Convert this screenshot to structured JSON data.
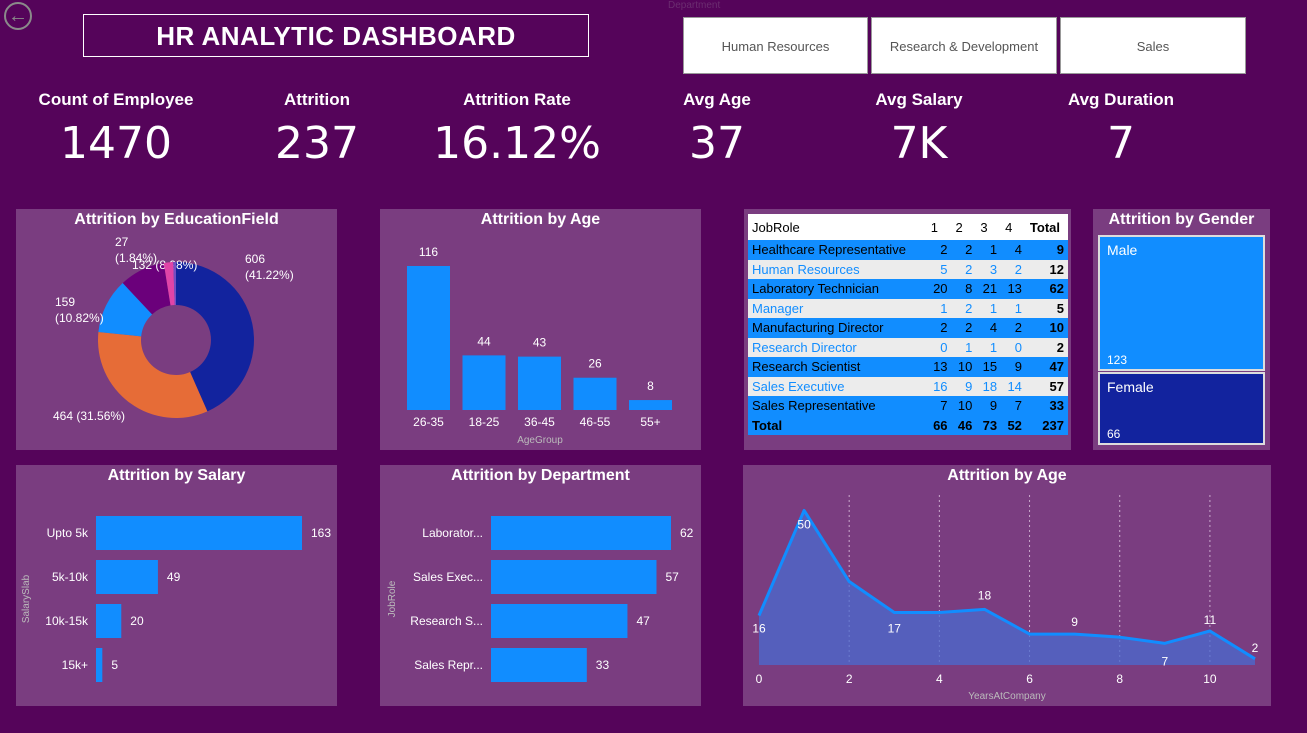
{
  "header": {
    "title": "HR ANALYTIC DASHBOARD",
    "back_icon": "arrow-left-icon"
  },
  "slicer": {
    "label": "Department",
    "options": [
      "Human Resources",
      "Research & Development",
      "Sales"
    ]
  },
  "kpis": [
    {
      "label": "Count of Employee",
      "value": "1470"
    },
    {
      "label": "Attrition",
      "value": "237"
    },
    {
      "label": "Attrition Rate",
      "value": "16.12%"
    },
    {
      "label": "Avg Age",
      "value": "37"
    },
    {
      "label": "Avg Salary",
      "value": "7K"
    },
    {
      "label": "Avg Duration",
      "value": "7"
    }
  ],
  "colors": {
    "background": "#55045a",
    "panel": "#7a3d80",
    "bar": "#118dff",
    "dark_blue": "#12239e"
  },
  "chart_data": [
    {
      "type": "pie",
      "title": "Attrition by EducationField",
      "slices": [
        {
          "value": 606,
          "label": "606",
          "pct": "(41.22%)",
          "color": "#12239e"
        },
        {
          "value": 464,
          "label": "464 (31.56%)",
          "pct": "",
          "color": "#e66c37"
        },
        {
          "value": 159,
          "label": "159",
          "pct": "(10.82%)",
          "color": "#118dff"
        },
        {
          "value": 132,
          "label": "132 (8.98%)",
          "pct": "",
          "color": "#6b007b"
        },
        {
          "value": 27,
          "label": "27",
          "pct": "(1.84%)",
          "color": "#e044a7"
        },
        {
          "value": 8,
          "label": "",
          "pct": "",
          "color": "#744ec2"
        }
      ]
    },
    {
      "type": "bar",
      "title": "Attrition by Age",
      "xlabel": "AgeGroup",
      "categories": [
        "26-35",
        "18-25",
        "36-45",
        "46-55",
        "55+"
      ],
      "values": [
        116,
        44,
        43,
        26,
        8
      ]
    },
    {
      "type": "table",
      "title": "",
      "columns": [
        "JobRole",
        "1",
        "2",
        "3",
        "4",
        "Total"
      ],
      "rows": [
        [
          "Healthcare Representative",
          "2",
          "2",
          "1",
          "4",
          "9"
        ],
        [
          "Human Resources",
          "5",
          "2",
          "3",
          "2",
          "12"
        ],
        [
          "Laboratory Technician",
          "20",
          "8",
          "21",
          "13",
          "62"
        ],
        [
          "Manager",
          "1",
          "2",
          "1",
          "1",
          "5"
        ],
        [
          "Manufacturing Director",
          "2",
          "2",
          "4",
          "2",
          "10"
        ],
        [
          "Research Director",
          "0",
          "1",
          "1",
          "0",
          "2"
        ],
        [
          "Research Scientist",
          "13",
          "10",
          "15",
          "9",
          "47"
        ],
        [
          "Sales Executive",
          "16",
          "9",
          "18",
          "14",
          "57"
        ],
        [
          "Sales Representative",
          "7",
          "10",
          "9",
          "7",
          "33"
        ]
      ],
      "total": [
        "Total",
        "66",
        "46",
        "73",
        "52",
        "237"
      ]
    },
    {
      "type": "treemap",
      "title": "Attrition by Gender",
      "categories": [
        "Male",
        "Female"
      ],
      "values": [
        123,
        66
      ]
    },
    {
      "type": "bar",
      "orientation": "horizontal",
      "title": "Attrition by Salary",
      "ylabel": "SalarySlab",
      "categories": [
        "Upto 5k",
        "5k-10k",
        "10k-15k",
        "15k+"
      ],
      "values": [
        163,
        49,
        20,
        5
      ]
    },
    {
      "type": "bar",
      "orientation": "horizontal",
      "title": "Attrition by Department",
      "ylabel": "JobRole",
      "categories": [
        "Laborator...",
        "Sales Exec...",
        "Research S...",
        "Sales Repr..."
      ],
      "values": [
        62,
        57,
        47,
        33
      ]
    },
    {
      "type": "area",
      "title": "Attrition by Age",
      "xlabel": "YearsAtCompany",
      "x": [
        0,
        1,
        2,
        3,
        4,
        5,
        6,
        7,
        8,
        9,
        10,
        11
      ],
      "y": [
        16,
        50,
        27,
        17,
        17,
        18,
        10,
        10,
        9,
        7,
        11,
        2
      ],
      "point_labels": {
        "0": "16",
        "1": "50",
        "3": "17",
        "5": "18",
        "7": "9",
        "9": "7",
        "10": "11",
        "11": "2"
      },
      "xticks": [
        "0",
        "2",
        "4",
        "6",
        "8",
        "10"
      ],
      "xlim": [
        0,
        11
      ],
      "ylim": [
        0,
        55
      ]
    }
  ]
}
